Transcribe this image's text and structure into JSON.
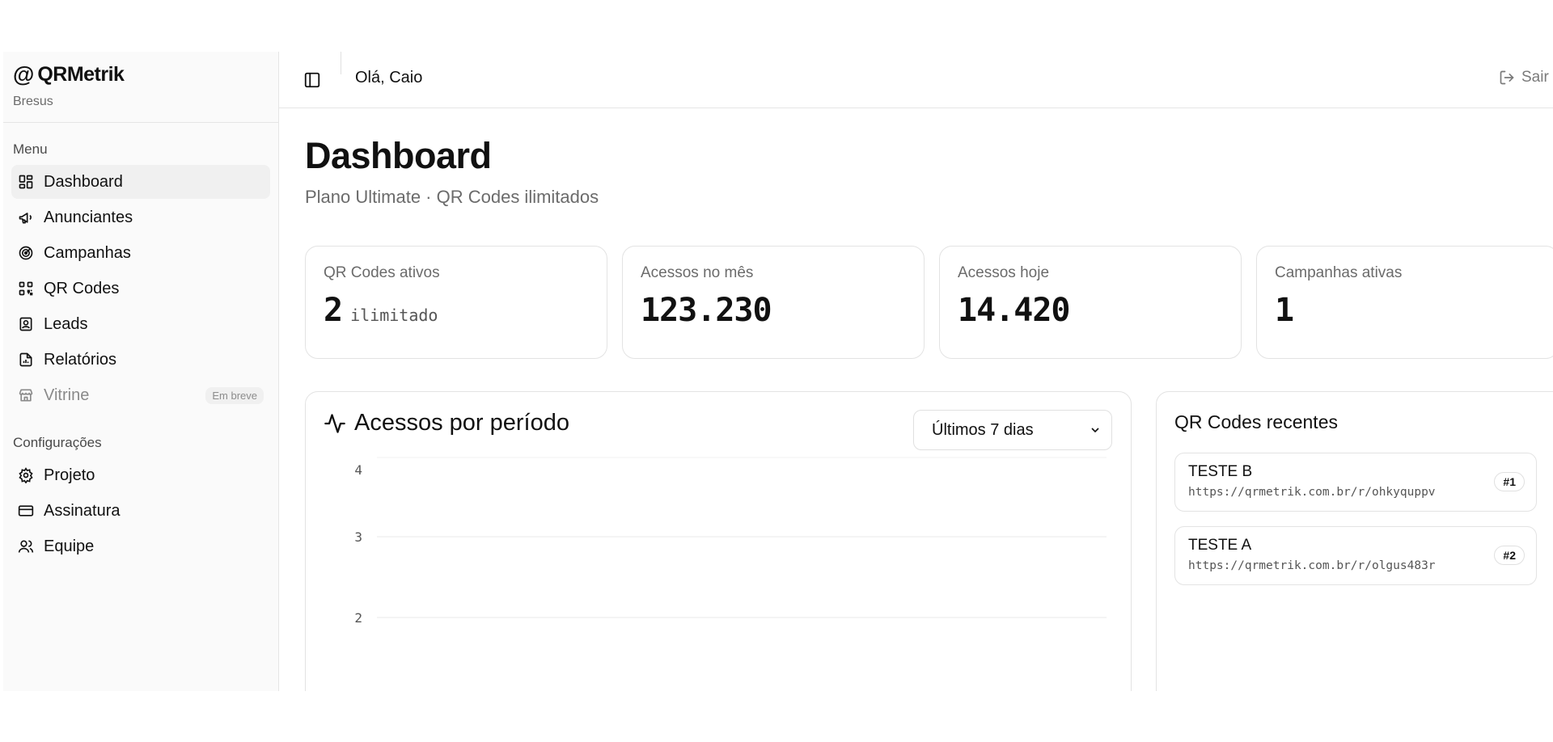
{
  "brand": {
    "logo": "@",
    "name": "QRMetrik",
    "subtitle": "Bresus"
  },
  "sidebar": {
    "menu_label": "Menu",
    "menu_items": [
      {
        "label": "Dashboard",
        "icon": "dashboard-icon",
        "active": true
      },
      {
        "label": "Anunciantes",
        "icon": "megaphone-icon"
      },
      {
        "label": "Campanhas",
        "icon": "target-icon"
      },
      {
        "label": "QR Codes",
        "icon": "qr-code-icon"
      },
      {
        "label": "Leads",
        "icon": "contact-icon"
      },
      {
        "label": "Relatórios",
        "icon": "report-icon"
      },
      {
        "label": "Vitrine",
        "icon": "store-icon",
        "disabled": true,
        "badge": "Em breve"
      }
    ],
    "settings_label": "Configurações",
    "settings_items": [
      {
        "label": "Projeto",
        "icon": "gear-icon"
      },
      {
        "label": "Assinatura",
        "icon": "credit-card-icon"
      },
      {
        "label": "Equipe",
        "icon": "users-icon"
      }
    ]
  },
  "header": {
    "greeting": "Olá, Caio",
    "logout_label": "Sair"
  },
  "page": {
    "title": "Dashboard",
    "subtitle": "Plano Ultimate · QR Codes ilimitados"
  },
  "stats": [
    {
      "label": "QR Codes ativos",
      "value": "2",
      "unit": "ilimitado"
    },
    {
      "label": "Acessos no mês",
      "value": "123.230"
    },
    {
      "label": "Acessos hoje",
      "value": "14.420"
    },
    {
      "label": "Campanhas ativas",
      "value": "1"
    }
  ],
  "chart": {
    "title": "Acessos por período",
    "period": {
      "selected": "Últimos 7 dias"
    },
    "yticks": [
      "4",
      "3",
      "2"
    ]
  },
  "recent": {
    "title": "QR Codes recentes",
    "items": [
      {
        "name": "TESTE B",
        "url": "https://qrmetrik.com.br/r/ohkyquppv",
        "badge": "#1"
      },
      {
        "name": "TESTE A",
        "url": "https://qrmetrik.com.br/r/olgus483r",
        "badge": "#2"
      }
    ]
  },
  "colors": {
    "text": "#111111",
    "muted": "#6b6b6b",
    "border": "#e3e3e3",
    "sidebar_bg": "#fafafa",
    "active_bg": "#f0f0f0"
  }
}
